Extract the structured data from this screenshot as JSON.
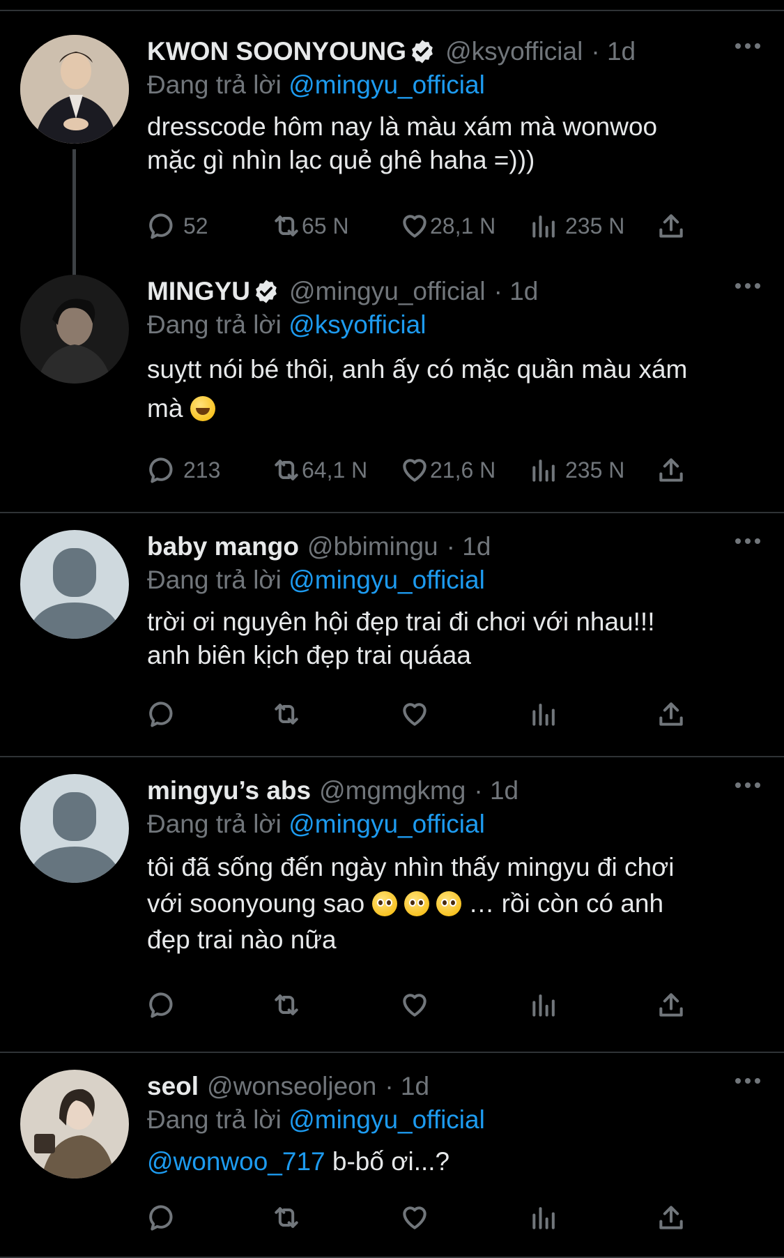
{
  "reply_prefix": "Đang trả lời",
  "tweets": [
    {
      "name": "KWON SOONYOUNG",
      "verified": true,
      "handle": "@ksyofficial",
      "time": "· 1d",
      "reply_to": "@mingyu_official",
      "text": "dresscode hôm nay là màu xám mà wonwoo\nmặc gì nhìn lạc quẻ ghê haha =)))",
      "stats": {
        "replies": "52",
        "retweets": "65 N",
        "likes": "28,1 N",
        "views": "235 N"
      },
      "avatar": "photo"
    },
    {
      "name": "MINGYU",
      "verified": true,
      "handle": "@mingyu_official",
      "time": "· 1d",
      "reply_to": "@ksyofficial",
      "text_a": "suỵtt nói bé thôi, anh ấy có mặc quần màu xám\nmà ",
      "emoji": "laughing-face",
      "stats": {
        "replies": "213",
        "retweets": "64,1 N",
        "likes": "21,6 N",
        "views": "235 N"
      },
      "avatar": "photo"
    },
    {
      "name": "baby mango",
      "verified": false,
      "handle": "@bbimingu",
      "time": "· 1d",
      "reply_to": "@mingyu_official",
      "text": "trời ơi nguyên hội đẹp trai đi chơi với nhau!!!\nanh biên kịch đẹp trai quáaa",
      "avatar": "default"
    },
    {
      "name": "mingyu’s abs",
      "verified": false,
      "handle": "@mgmgkmg",
      "time": "· 1d",
      "reply_to": "@mingyu_official",
      "text_a": "tôi đã sống đến ngày nhìn thấy mingyu đi chơi\nvới soonyoung sao ",
      "text_b": " … rồi còn có anh\nđẹp trai nào nữa",
      "emoji": "pleading-face",
      "avatar": "default"
    },
    {
      "name": "seol",
      "verified": false,
      "handle": "@wonseoljeon",
      "time": "· 1d",
      "reply_to": "@mingyu_official",
      "mention": "@wonwoo_717",
      "text": " b-bố ơi...?",
      "avatar": "photo"
    }
  ]
}
